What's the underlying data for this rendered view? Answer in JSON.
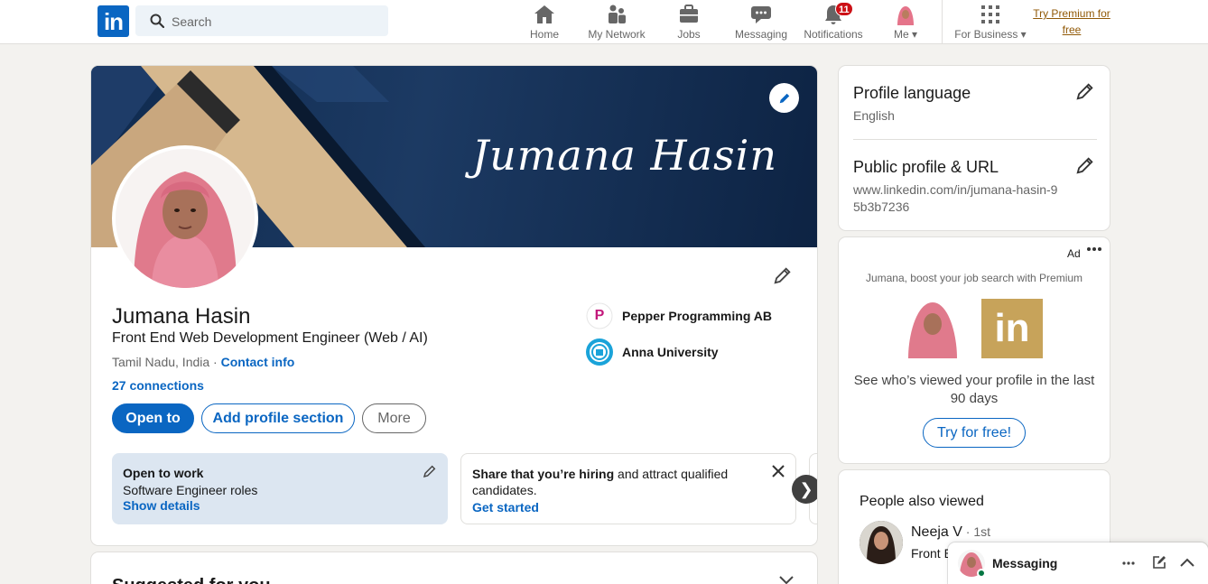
{
  "nav": {
    "logo": "in",
    "search_placeholder": "Search",
    "items": [
      {
        "label": "Home"
      },
      {
        "label": "My Network"
      },
      {
        "label": "Jobs"
      },
      {
        "label": "Messaging"
      },
      {
        "label": "Notifications",
        "badge": "11"
      },
      {
        "label": "Me"
      },
      {
        "label": "For Business"
      }
    ],
    "premium_link_line1": "Try Premium for",
    "premium_link_line2": "free"
  },
  "profile": {
    "banner_text": "Jumana Hasin",
    "name": "Jumana Hasin",
    "headline": "Front End Web Development Engineer (Web / AI)",
    "location": "Tamil Nadu, India",
    "separator": " · ",
    "contact_info": "Contact info",
    "connections": "27 connections",
    "buttons": {
      "open_to": "Open to",
      "add_section": "Add profile section",
      "more": "More"
    },
    "orgs": [
      {
        "name": "Pepper Programming AB",
        "logo_letter": "P"
      },
      {
        "name": "Anna University"
      }
    ],
    "open_to_work": {
      "title": "Open to work",
      "subtitle": "Software Engineer roles",
      "link": "Show details"
    },
    "hiring": {
      "bold": "Share that you’re hiring",
      "rest": " and attract qualified candidates.",
      "link": "Get started"
    },
    "next_glyph": "❯"
  },
  "suggested": {
    "title": "Suggested for you"
  },
  "right": {
    "profile_language_title": "Profile language",
    "profile_language_value": "English",
    "public_profile_title": "Public profile & URL",
    "public_profile_url": "www.linkedin.com/in/jumana-hasin-95b3b7236",
    "ad": {
      "label": "Ad",
      "tagline": "Jumana, boost your job search with Premium",
      "logo_text": "in",
      "text": "See who’s viewed your profile in the last 90 days",
      "button": "Try for free!"
    },
    "people_also_viewed": {
      "title": "People also viewed",
      "person_name": "Neeja V",
      "person_degree": " · 1st",
      "person_headline": "Front End Engine..."
    }
  },
  "messaging": {
    "label": "Messaging"
  },
  "colors": {
    "brand": "#0a66c2",
    "premium": "#915907",
    "badge": "#cc1016",
    "open_to_work_bg": "#dce6f1"
  }
}
